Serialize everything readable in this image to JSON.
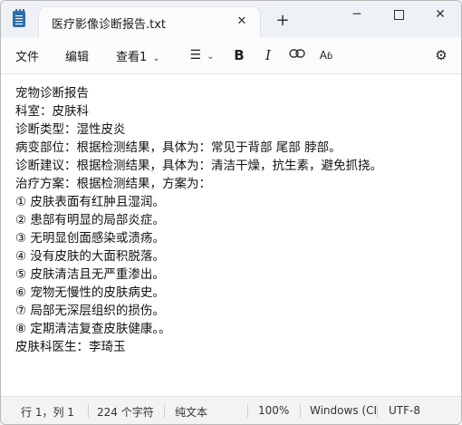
{
  "tab": {
    "title": "医疗影像诊断报告.txt",
    "close_icon": "close-icon"
  },
  "window_controls": {
    "minimize": "─",
    "close": "✕",
    "new_tab": "+"
  },
  "menu": {
    "file": "文件",
    "edit": "编辑",
    "view": "查看"
  },
  "toolbar": {
    "view_indicator": "1",
    "bold": "B",
    "italic": "I",
    "link": "⊖",
    "spellcheck": "A",
    "list": "☰",
    "settings": "⚙"
  },
  "document": {
    "lines": [
      "宠物诊断报告",
      "科室：皮肤科",
      "诊断类型：湿性皮炎",
      "病变部位：根据检测结果，具体为：常见于背部 尾部 脖部。",
      "诊断建议：根据检测结果，具体为：清洁干燥，抗生素，避免抓挠。",
      "治疗方案：根据检测结果，方案为：",
      "① 皮肤表面有红肿且湿润。",
      "② 患部有明显的局部炎症。",
      "③ 无明显创面感染或溃疡。",
      "④ 没有皮肤的大面积脱落。",
      "⑤ 皮肤清洁且无严重渗出。",
      "⑥ 宠物无慢性的皮肤病史。",
      "⑦ 局部无深层组织的损伤。",
      "⑧ 定期清洁复查皮肤健康。。",
      "皮肤科医生：李琦玉"
    ]
  },
  "status": {
    "position": "行 1，列 1",
    "chars": "224 个字符",
    "format": "纯文本",
    "zoom": "100%",
    "line_ending": "Windows (CI",
    "encoding": "UTF-8"
  }
}
